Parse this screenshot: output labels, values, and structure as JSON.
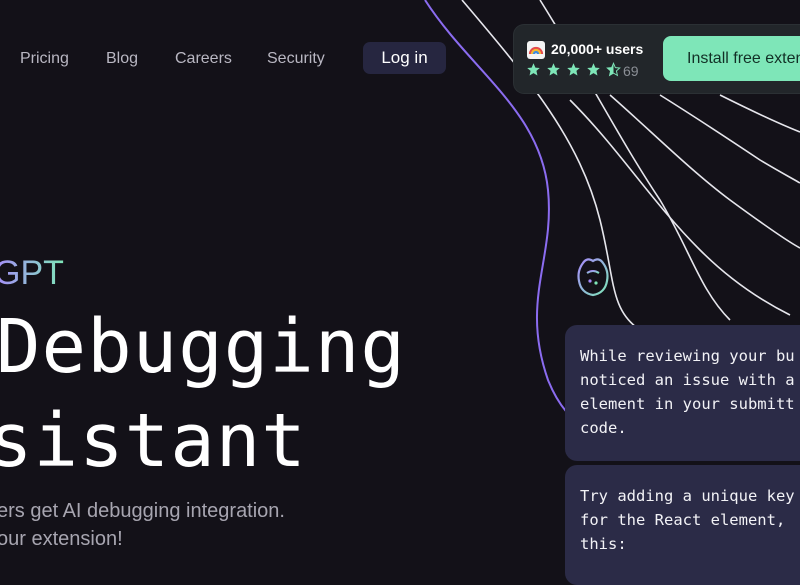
{
  "nav": {
    "links": [
      "Pricing",
      "Blog",
      "Careers",
      "Security"
    ],
    "login_label": "Log in"
  },
  "promo": {
    "users_label": "20,000+ users",
    "rating_count": "69",
    "stars": 4.5,
    "install_label": "Install free exten"
  },
  "hero": {
    "brand_suffix": "GPT",
    "title_line1": "Debugging",
    "title_line2": "sistant",
    "subtitle_line1": "ers get AI debugging integration.",
    "subtitle_line2": "our extension!"
  },
  "chat": {
    "message1": [
      "While reviewing your bu",
      "noticed an issue with a",
      "element in your submitt",
      "code."
    ],
    "message2": [
      "Try adding a unique key",
      "for the React element,",
      "this:"
    ]
  },
  "colors": {
    "background": "#131118",
    "accent_green": "#7ee6b8",
    "accent_purple": "#a78bfa",
    "bubble": "#2b2b47",
    "login_bg": "#262640"
  },
  "icons": [
    "chrome-logo-icon",
    "star-icon",
    "bot-icon"
  ]
}
